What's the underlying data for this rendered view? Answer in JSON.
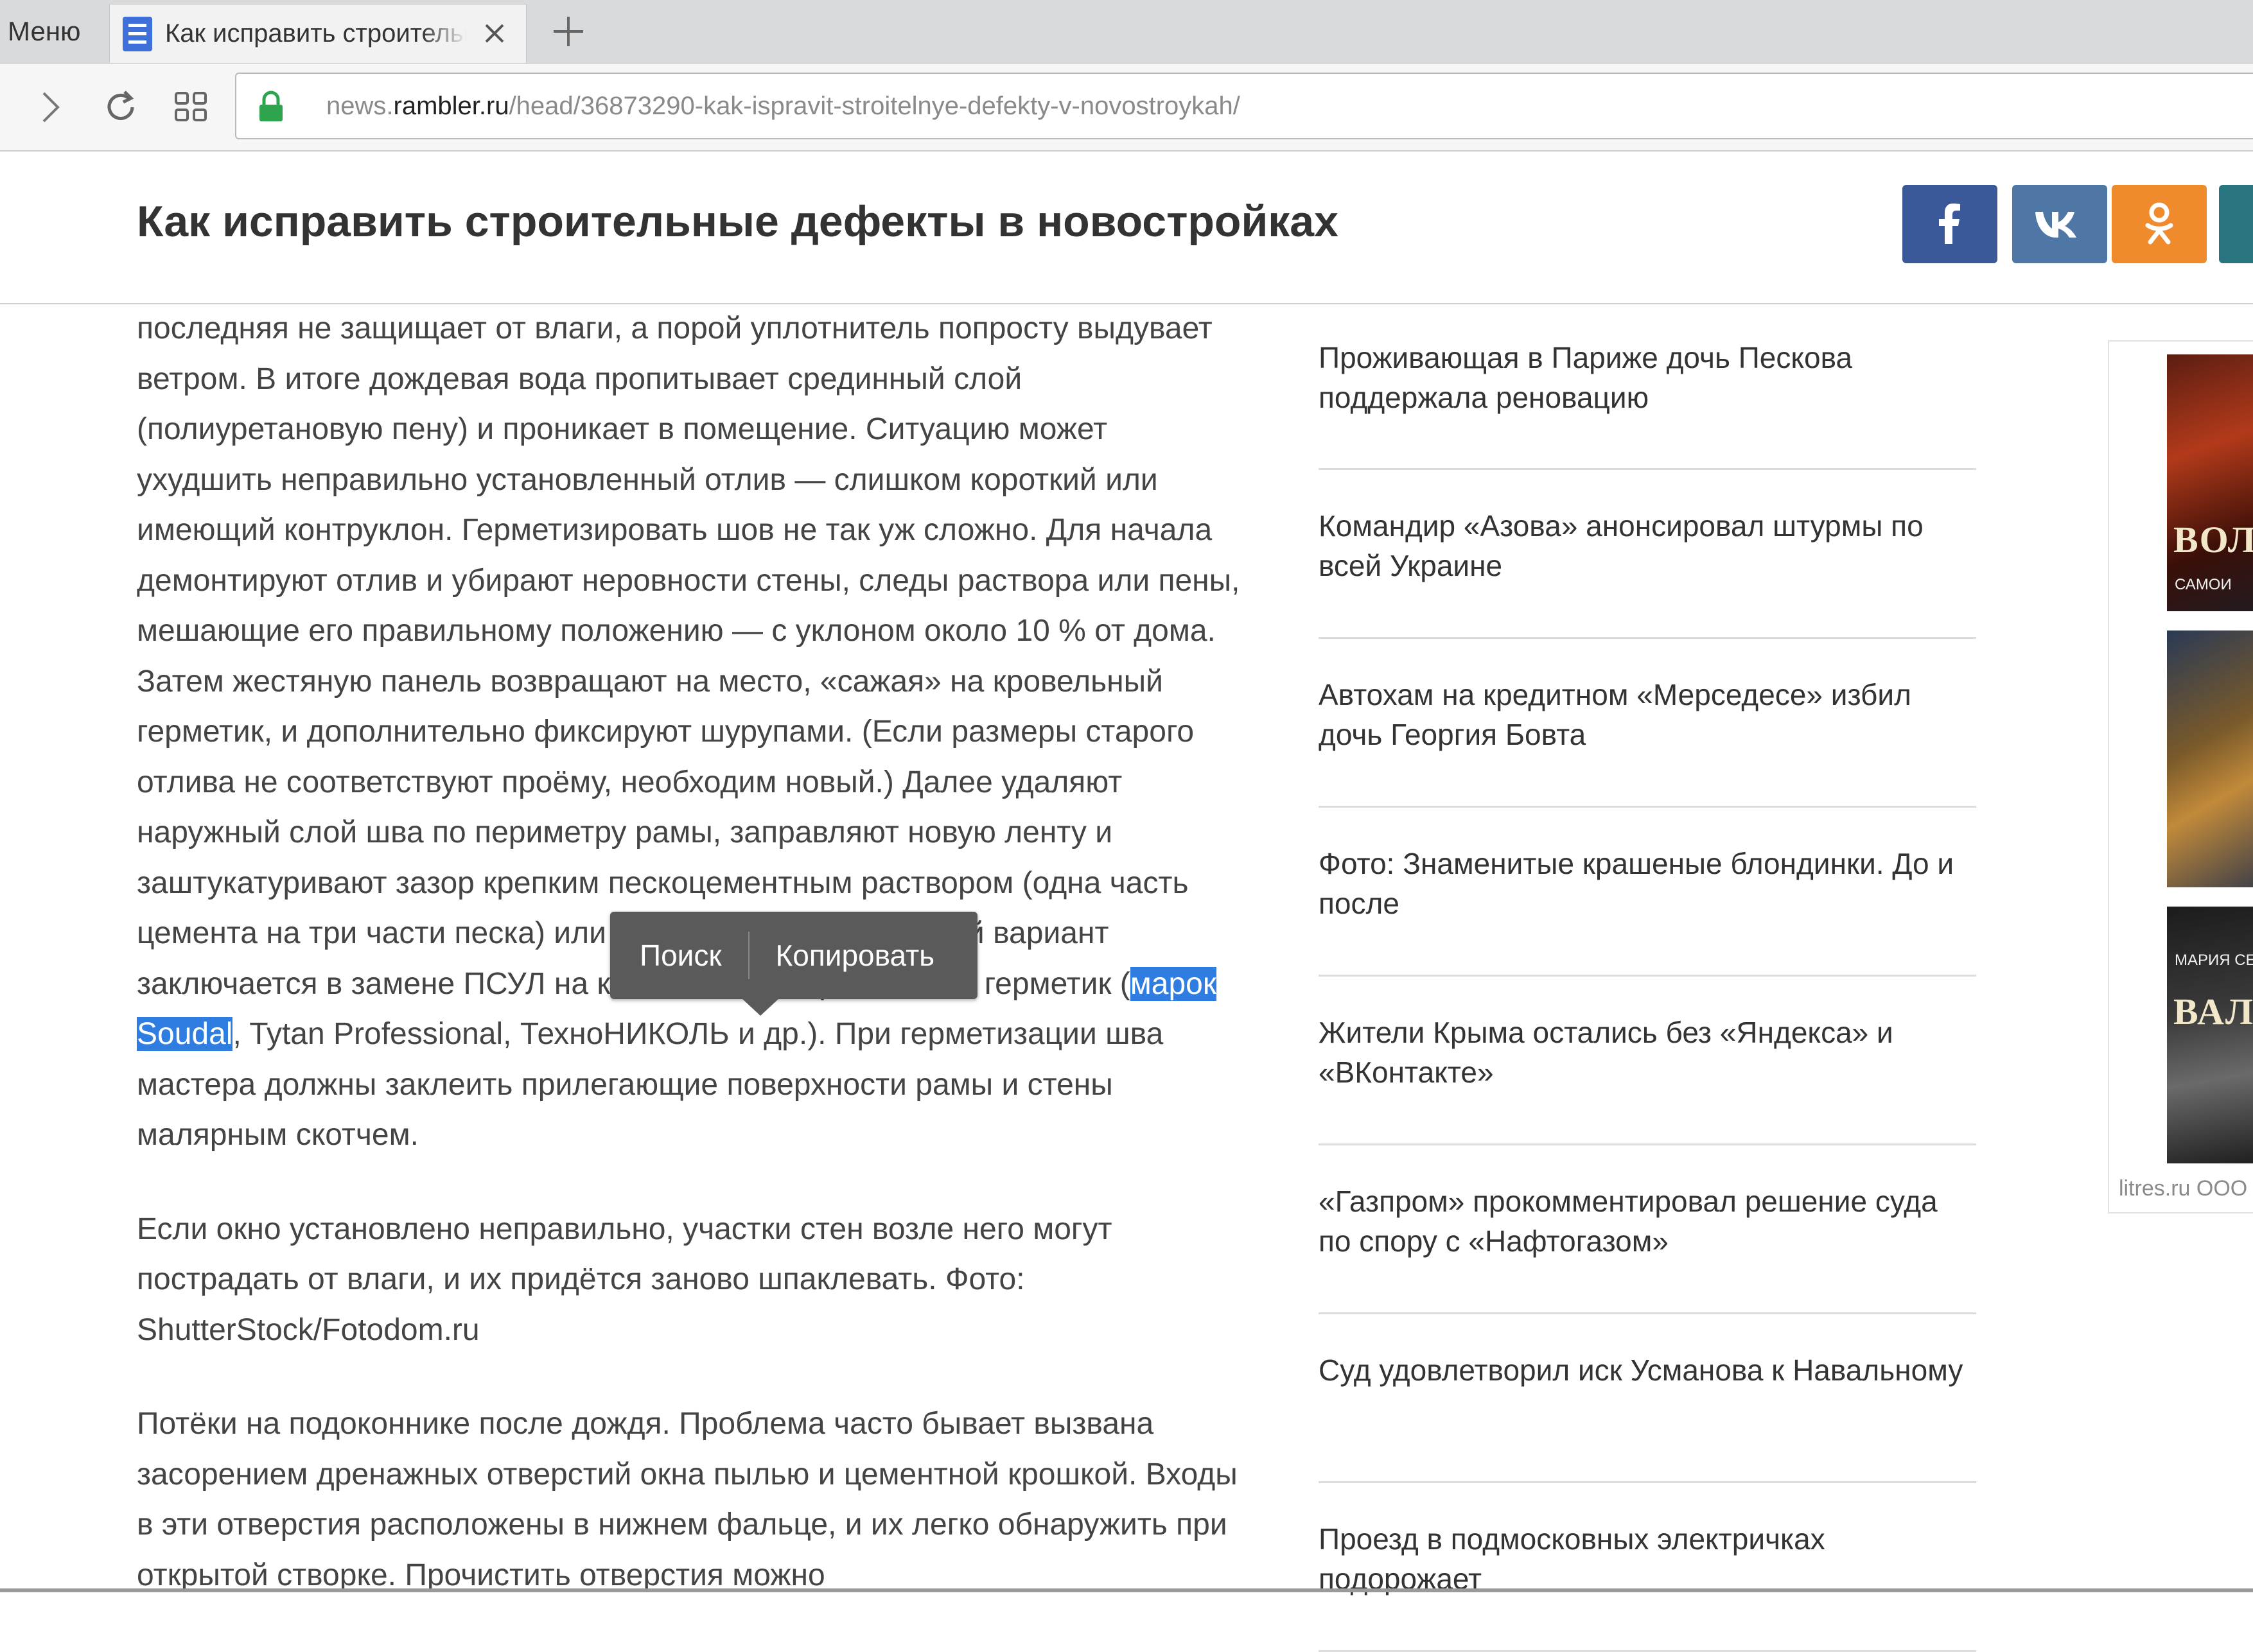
{
  "browser": {
    "menu_label": "Меню",
    "tab_title": "Как исправить строительные дефекты в новостройках",
    "url_prefix": "news.",
    "url_domain": "rambler.ru",
    "url_path": "/head/36873290-kak-ispravit-stroitelnye-defekty-v-novostroykah/",
    "accent_color": "#3f6fd8",
    "lock_color": "#2ea44f"
  },
  "header": {
    "title": "Как исправить строительные дефекты в новостройках",
    "share_buttons": [
      {
        "network": "facebook",
        "icon": "facebook-icon",
        "color": "#3b5998"
      },
      {
        "network": "vk",
        "icon": "vk-icon",
        "color": "#4f77a6"
      },
      {
        "network": "odnoklassniki",
        "icon": "odnoklassniki-icon",
        "color": "#ef8b2c"
      },
      {
        "network": "more",
        "icon": "share-icon",
        "color": "#29757f"
      }
    ]
  },
  "article": {
    "p1_before": "последняя не защищает от влаги, а порой уплотнитель попросту выдувает ветром. В итоге дождевая вода пропитывает срединный слой (полиуретановую пену) и проникает в помещение. Ситуацию может ухудшить неправильно установленный отлив — слишком короткий или имеющий контруклон. Герметизировать шов не так уж сложно. Для начала демонтируют отлив и убирают неровности стены, следы раствора или пены, мешающие его правильному положению — с уклоном около 10 % от дома. Затем жестяную панель возвращают на место, «сажая» на кровельный герметик, и дополнительно фиксируют шурупами. (Если размеры старого отлива не соответствуют проёму, необходим новый.) Далее удаляют наружный слой шва по периметру рамы, заправляют новую ленту и заштукатуривают зазор крепким пескоцементным раствором (одна часть цемента на три части песка) или плиточным клеем. Другой вариант заключается в замене ПСУЛ на качественный кровельный герметик (",
    "p1_selected": "марок Soudal",
    "p1_after": ", Tytan Professional, ТехноНИКОЛЬ и др.). При герметизации шва мастера должны заклеить прилегающие поверхности рамы и стены малярным скотчем.",
    "p2": "Если окно установлено неправильно, участки стен возле него могут пострадать от влаги, и их придётся заново шпаклевать. Фото: ShutterStock/Fotodom.ru",
    "p3": "Потёки на подоконнике после дождя. Проблема часто бывает вызвана засорением дренажных отверстий окна пылью и цементной крошкой. Входы в эти отверстия расположены в нижнем фальце, и их легко обнаружить при открытой створке. Прочистить отверстия можно",
    "selection_color": "#2f7de0"
  },
  "context_menu": {
    "search_label": "Поиск",
    "copy_label": "Копировать"
  },
  "news": [
    {
      "title": "Проживающая в Париже дочь Пескова поддержала реновацию"
    },
    {
      "title": "Командир «Азова» анонсировал штурмы по всей Украине"
    },
    {
      "title": "Автохам на кредитном «Мерседесе» избил дочь Георгия Бовта"
    },
    {
      "title": "Фото: Знаменитые крашеные блондинки. До и после"
    },
    {
      "title": "Жители Крыма остались без «Яндекса» и «ВКонтакте»"
    },
    {
      "title": "«Газпром» прокомментировал решение суда по спору с «Нафтогазом»"
    },
    {
      "title": "Суд удовлетворил иск Усманова к Навальному"
    },
    {
      "title": "Проезд в подмосковных электричках подорожает"
    }
  ],
  "ad": {
    "books": [
      {
        "cover_text": "ВОЛК",
        "small_text": "САМОИ"
      },
      {
        "cover_text": "",
        "small_text": ""
      },
      {
        "cover_text": "ВАЛЬ",
        "small_text": "МАРИЯ СЕМЁНОВА"
      }
    ],
    "source": "litres.ru ООО"
  }
}
